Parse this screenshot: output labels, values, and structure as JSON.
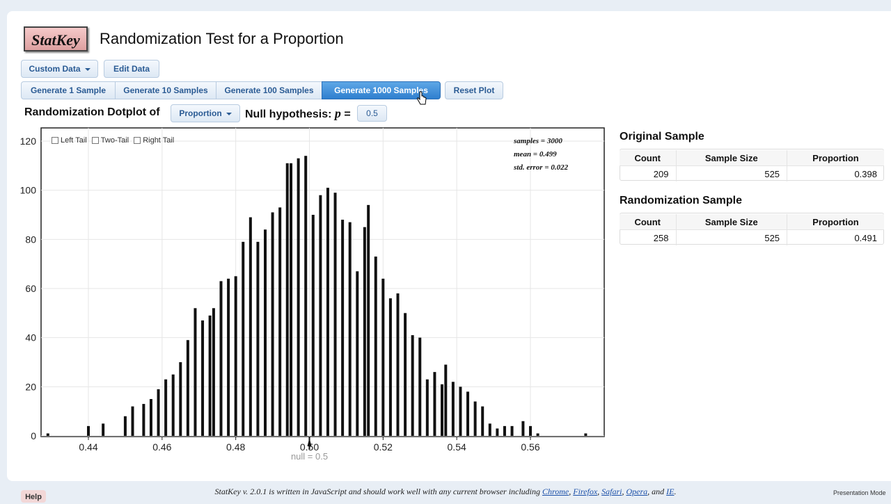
{
  "app": {
    "logo_text": "StatKey",
    "title": "Randomization Test for a Proportion"
  },
  "toolbar": {
    "custom_data_label": "Custom Data",
    "edit_data_label": "Edit Data",
    "generate_buttons": [
      "Generate 1 Sample",
      "Generate 10 Samples",
      "Generate 100 Samples",
      "Generate 1000 Samples"
    ],
    "active_generate": "Generate 1000 Samples",
    "reset_label": "Reset Plot"
  },
  "dotplot": {
    "label": "Randomization Dotplot of",
    "statistic_selected": "Proportion",
    "null_label": "Null hypothesis:",
    "null_param": "p",
    "null_equals": "=",
    "null_value": "0.5"
  },
  "tails": {
    "left": "Left Tail",
    "two": "Two-Tail",
    "right": "Right Tail"
  },
  "stats": {
    "samples": "samples = 3000",
    "mean": "mean = 0.499",
    "se": "std. error = 0.022"
  },
  "chart_data": {
    "type": "bar",
    "x": [
      0.429,
      0.44,
      0.444,
      0.45,
      0.452,
      0.455,
      0.457,
      0.459,
      0.461,
      0.463,
      0.465,
      0.467,
      0.469,
      0.471,
      0.473,
      0.474,
      0.476,
      0.478,
      0.48,
      0.482,
      0.484,
      0.486,
      0.488,
      0.49,
      0.492,
      0.494,
      0.495,
      0.497,
      0.499,
      0.501,
      0.503,
      0.505,
      0.507,
      0.509,
      0.511,
      0.513,
      0.515,
      0.516,
      0.518,
      0.52,
      0.522,
      0.524,
      0.526,
      0.528,
      0.53,
      0.532,
      0.534,
      0.536,
      0.537,
      0.539,
      0.541,
      0.543,
      0.545,
      0.547,
      0.549,
      0.551,
      0.553,
      0.555,
      0.558,
      0.56,
      0.562,
      0.575
    ],
    "values": [
      1,
      4,
      5,
      8,
      12,
      13,
      15,
      19,
      23,
      25,
      30,
      39,
      52,
      47,
      49,
      52,
      63,
      64,
      65,
      79,
      89,
      79,
      84,
      91,
      93,
      111,
      111,
      113,
      114,
      90,
      98,
      101,
      99,
      88,
      87,
      67,
      85,
      94,
      73,
      64,
      56,
      58,
      50,
      41,
      40,
      23,
      26,
      21,
      29,
      22,
      20,
      18,
      14,
      12,
      5,
      3,
      4,
      4,
      6,
      4,
      1,
      1
    ],
    "xticks": [
      "0.44",
      "0.46",
      "0.48",
      "0.50",
      "0.52",
      "0.54",
      "0.56"
    ],
    "yticks": [
      "0",
      "20",
      "40",
      "60",
      "80",
      "100",
      "120"
    ],
    "xlim": [
      0.43,
      0.58
    ],
    "ylim": [
      0,
      120
    ],
    "null_marker_label": "null = 0.5",
    "null_marker_x": 0.5,
    "grid": true
  },
  "original_sample": {
    "title": "Original Sample",
    "headers": [
      "Count",
      "Sample Size",
      "Proportion"
    ],
    "row": [
      "209",
      "525",
      "0.398"
    ]
  },
  "randomization_sample": {
    "title": "Randomization Sample",
    "headers": [
      "Count",
      "Sample Size",
      "Proportion"
    ],
    "row": [
      "258",
      "525",
      "0.491"
    ]
  },
  "footer": {
    "prefix": "StatKey v. 2.0.1 is written in JavaScript and should work well with any current browser including",
    "browsers": [
      "Chrome",
      "Firefox",
      "Safari",
      "Opera",
      "IE"
    ],
    "suffix": "."
  },
  "help_label": "Help",
  "presentation_label": "Presentation Mode"
}
